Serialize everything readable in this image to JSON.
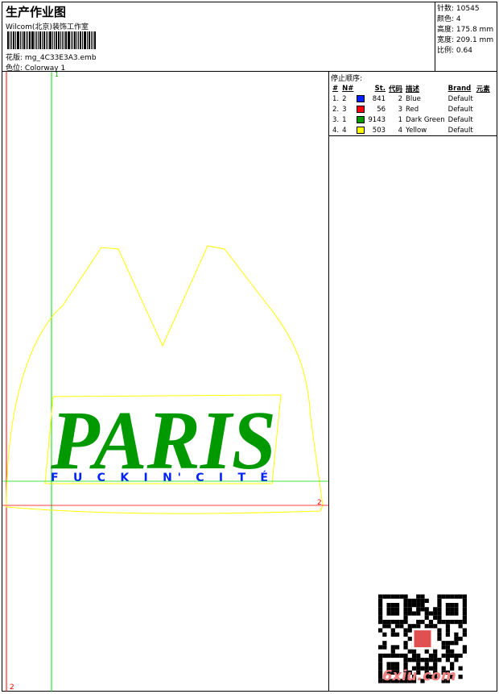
{
  "header": {
    "title": "生产作业图",
    "company": "Wilcom(北京)装饰工作室",
    "file_label": "花版:",
    "file_name": "mg_4C33E3A3.emb",
    "colorway_label": "色位:",
    "colorway": "Colorway 1"
  },
  "stats": [
    {
      "label": "针数:",
      "value": "10545"
    },
    {
      "label": "颜色:",
      "value": "4"
    },
    {
      "label": "高度:",
      "value": "175.8 mm"
    },
    {
      "label": "宽度:",
      "value": "209.1 mm"
    },
    {
      "label": "比例:",
      "value": "0.64"
    }
  ],
  "stop_sequence": {
    "title": "停止顺序:",
    "columns": [
      "#",
      "N#",
      "St.",
      "代码",
      "描述",
      "Brand",
      "元素"
    ],
    "rows": [
      {
        "idx": "1.",
        "n": "2",
        "color": "#0022ff",
        "st": "841",
        "code": "2",
        "desc": "Blue",
        "brand": "Default"
      },
      {
        "idx": "2.",
        "n": "3",
        "color": "#ff0000",
        "st": "56",
        "code": "3",
        "desc": "Red",
        "brand": "Default"
      },
      {
        "idx": "3.",
        "n": "1",
        "color": "#009900",
        "st": "9143",
        "code": "1",
        "desc": "Dark Green",
        "brand": "Default"
      },
      {
        "idx": "4.",
        "n": "4",
        "color": "#ffff00",
        "st": "503",
        "code": "4",
        "desc": "Yellow",
        "brand": "Default"
      }
    ]
  },
  "design": {
    "main_text": "PARIS",
    "sub_text": "F U C K I N'   C I T É",
    "marker_top": "1",
    "marker_right": "2",
    "marker_bottom": "2"
  },
  "watermark": "6xiu.com"
}
